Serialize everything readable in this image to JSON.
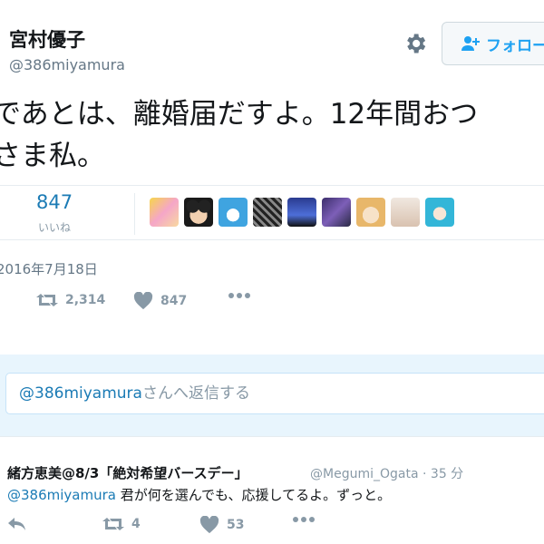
{
  "author": {
    "display_name": "宮村優子",
    "handle": "@386miyamura"
  },
  "header": {
    "follow_label": "フォロー",
    "settings_icon": "gear-icon"
  },
  "tweet": {
    "line1": "であとは、離婚届だすよ。12年間おつ",
    "line2": "さま私。",
    "date": "2016年7月18日"
  },
  "stats": {
    "likes_count": "847",
    "likes_label": "いいね"
  },
  "actions": {
    "retweet_count": "2,314",
    "like_count": "847"
  },
  "reply_box": {
    "mention": "@386miyamura",
    "placeholder": "さんへ返信する"
  },
  "reply": {
    "name": "緒方恵美@8/3「絶対希望バースデー」",
    "handle": "@Megumi_Ogata",
    "time": "35 分",
    "mention": "@386miyamura",
    "text": "君が何を選んでも、応援してるよ。ずっと。",
    "retweet_count": "4",
    "like_count": "53"
  },
  "colors": {
    "accent": "#1da1f2",
    "link": "#1b7bb5",
    "muted": "#8899a6",
    "reply_bg": "#e8f5fd"
  }
}
